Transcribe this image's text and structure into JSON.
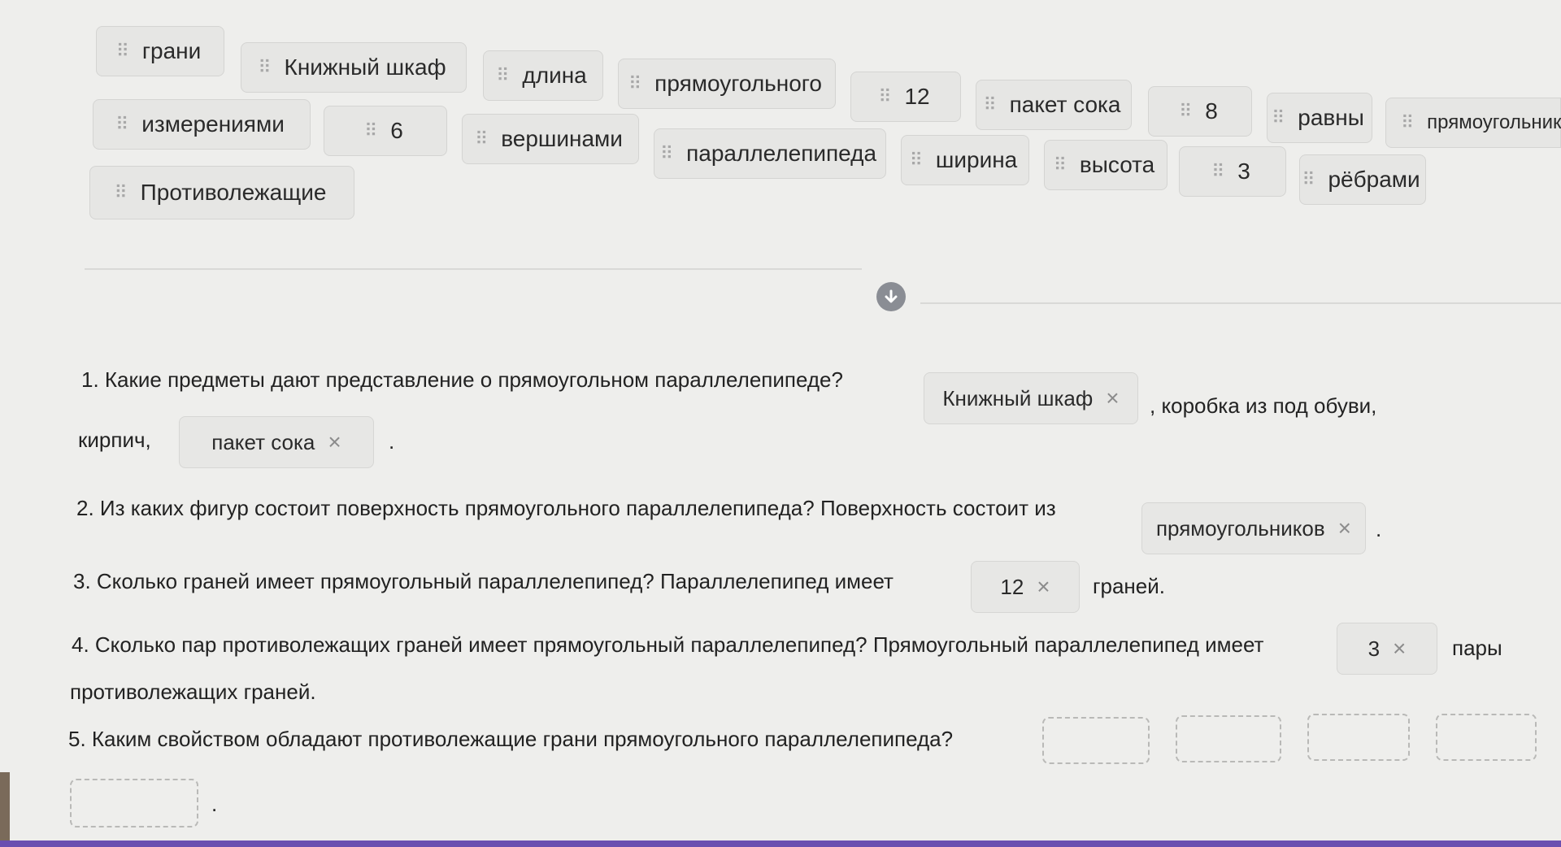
{
  "word_bank": [
    {
      "id": "chip-grani",
      "label": "грани"
    },
    {
      "id": "chip-knizhny-shkaf",
      "label": "Книжный шкаф"
    },
    {
      "id": "chip-dlina",
      "label": "длина"
    },
    {
      "id": "chip-pryamougolnogo",
      "label": "прямоугольного"
    },
    {
      "id": "chip-12",
      "label": "12"
    },
    {
      "id": "chip-paket-soka",
      "label": "пакет сока"
    },
    {
      "id": "chip-8",
      "label": "8"
    },
    {
      "id": "chip-ravny",
      "label": "равны"
    },
    {
      "id": "chip-pryamougolnikov",
      "label": "прямоугольнико"
    },
    {
      "id": "chip-izmereniyami",
      "label": "измерениями"
    },
    {
      "id": "chip-6",
      "label": "6"
    },
    {
      "id": "chip-vershinami",
      "label": "вершинами"
    },
    {
      "id": "chip-parallelepipeda",
      "label": "параллелепипеда"
    },
    {
      "id": "chip-shirina",
      "label": "ширина"
    },
    {
      "id": "chip-vysota",
      "label": "высота"
    },
    {
      "id": "chip-3",
      "label": "3"
    },
    {
      "id": "chip-rebrami",
      "label": "рёбрами"
    },
    {
      "id": "chip-protivolezhashchie",
      "label": "Противолежащие"
    }
  ],
  "questions": {
    "q1": {
      "text": "1. Какие предметы дают представление о прямоугольном параллелепипеде?",
      "answer1": "Книжный шкаф",
      "after1": ", коробка из под обуви,",
      "line2_prefix": "кирпич,",
      "answer2": "пакет сока",
      "end": "."
    },
    "q2": {
      "text": "2. Из каких фигур состоит поверхность прямоугольного параллелепипеда? Поверхность состоит из",
      "answer": "прямоугольников",
      "end": "."
    },
    "q3": {
      "text": "3. Сколько граней имеет прямоугольный параллелепипед? Параллелепипед имеет",
      "answer": "12",
      "after": "граней."
    },
    "q4": {
      "text": "4. Сколько пар противолежащих граней имеет прямоугольный параллелепипед? Прямоугольный параллелепипед имеет",
      "answer": "3",
      "after": "пары",
      "line2": "противолежащих граней."
    },
    "q5": {
      "text": "5. Каким свойством обладают противолежащие грани прямоугольного параллелепипеда?",
      "end": "."
    }
  },
  "icons": {
    "remove": "×",
    "grip": "⠿",
    "divider": "arrow-down-icon"
  },
  "colors": {
    "background": "#eeeeec",
    "chip": "#e6e6e4",
    "divider_button": "#8a8d94",
    "bottom_bar": "#6a4fb0"
  }
}
